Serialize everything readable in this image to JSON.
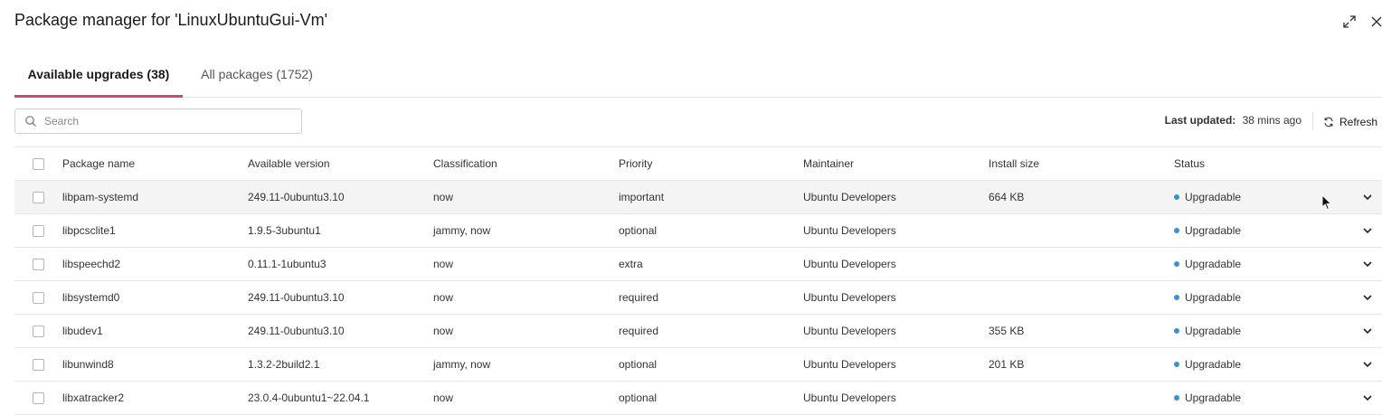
{
  "window": {
    "title": "Package manager for 'LinuxUbuntuGui-Vm'",
    "expand_icon": "expand-icon",
    "close_icon": "close-icon"
  },
  "tabs": [
    {
      "label": "Available upgrades (38)",
      "active": true
    },
    {
      "label": "All packages (1752)",
      "active": false
    }
  ],
  "search": {
    "placeholder": "Search",
    "value": ""
  },
  "last_updated": {
    "label": "Last updated:",
    "value": "38 mins ago"
  },
  "refresh": {
    "label": "Refresh",
    "icon": "refresh-icon"
  },
  "table": {
    "columns": [
      "Package name",
      "Available version",
      "Classification",
      "Priority",
      "Maintainer",
      "Install size",
      "Status"
    ],
    "rows": [
      [
        "libpam-systemd",
        "249.11-0ubuntu3.10",
        "now",
        "important",
        "Ubuntu Developers",
        "664 KB",
        "Upgradable"
      ],
      [
        "libpcsclite1",
        "1.9.5-3ubuntu1",
        "jammy, now",
        "optional",
        "Ubuntu Developers",
        "",
        "Upgradable"
      ],
      [
        "libspeechd2",
        "0.11.1-1ubuntu3",
        "now",
        "extra",
        "Ubuntu Developers",
        "",
        "Upgradable"
      ],
      [
        "libsystemd0",
        "249.11-0ubuntu3.10",
        "now",
        "required",
        "Ubuntu Developers",
        "",
        "Upgradable"
      ],
      [
        "libudev1",
        "249.11-0ubuntu3.10",
        "now",
        "required",
        "Ubuntu Developers",
        "355 KB",
        "Upgradable"
      ],
      [
        "libunwind8",
        "1.3.2-2build2.1",
        "jammy, now",
        "optional",
        "Ubuntu Developers",
        "201 KB",
        "Upgradable"
      ],
      [
        "libxatracker2",
        "23.0.4-0ubuntu1~22.04.1",
        "now",
        "optional",
        "Ubuntu Developers",
        "",
        "Upgradable"
      ]
    ]
  },
  "colors": {
    "accent": "#d0467a",
    "status_dot": "#3b8fd6"
  }
}
